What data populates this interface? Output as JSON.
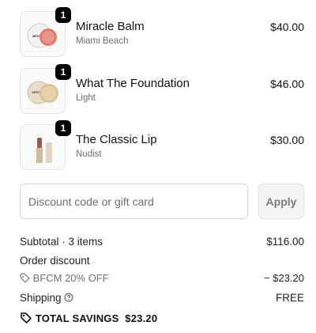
{
  "cart": {
    "items": [
      {
        "name": "Miracle Balm",
        "variant": "Miami Beach",
        "price": "$40.00",
        "quantity": "1",
        "thumbnail_icon": "balm-jar-icon"
      },
      {
        "name": "What The Foundation",
        "variant": "Light",
        "price": "$46.00",
        "quantity": "1",
        "thumbnail_icon": "foundation-jar-icon"
      },
      {
        "name": "The Classic Lip",
        "variant": "Nudist",
        "price": "$30.00",
        "quantity": "1",
        "thumbnail_icon": "lipstick-icon"
      }
    ]
  },
  "discount": {
    "placeholder": "Discount code or gift card",
    "apply_label": "Apply"
  },
  "summary": {
    "subtotal_label": "Subtotal · 3 items",
    "subtotal_value": "$116.00",
    "order_discount_label": "Order discount",
    "discount_code": "BFCM 20% OFF",
    "discount_value": "− $23.20",
    "shipping_label": "Shipping",
    "shipping_value": "FREE",
    "total_savings_label": "TOTAL SAVINGS",
    "total_savings_value": "$23.20"
  },
  "colors": {
    "qty_badge": "#000000",
    "muted_text": "#707070",
    "apply_button_bg": "#f5f5f5"
  }
}
